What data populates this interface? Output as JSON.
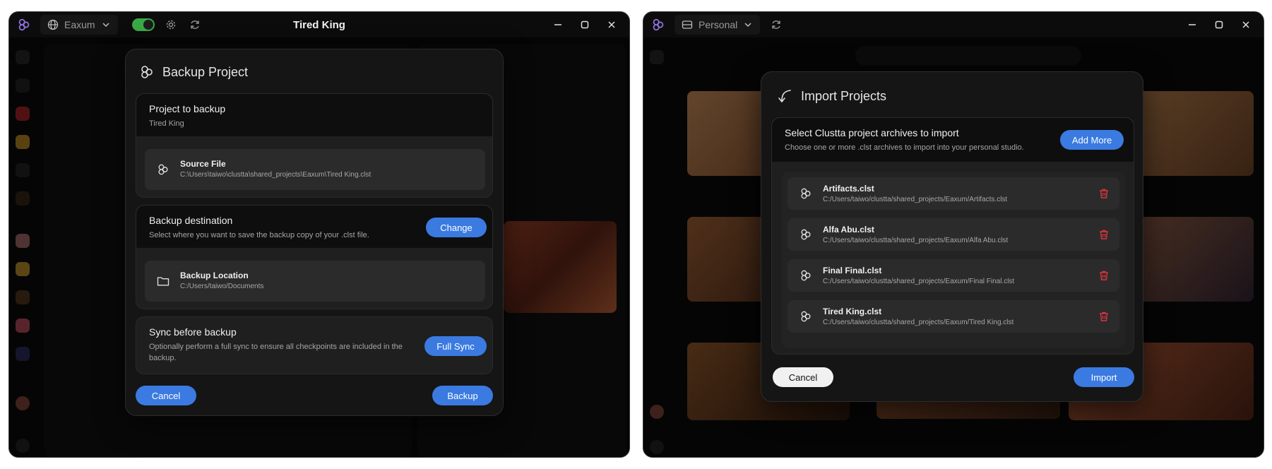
{
  "left_window": {
    "workspace": "Eaxum",
    "title": "Tired King",
    "modal": {
      "title": "Backup Project",
      "project_section": {
        "heading": "Project to backup",
        "project_name": "Tired King",
        "source_label": "Source File",
        "source_path": "C:\\Users\\taiwo\\clustta\\shared_projects\\Eaxum\\Tired King.clst"
      },
      "destination_section": {
        "heading": "Backup destination",
        "description": "Select where you want to save the backup copy of your .clst file.",
        "change_label": "Change",
        "location_label": "Backup Location",
        "location_path": "C:/Users/taiwo/Documents"
      },
      "sync_section": {
        "heading": "Sync before backup",
        "description": "Optionally perform a full sync to ensure all checkpoints are included in the backup.",
        "button_label": "Full Sync"
      },
      "cancel_label": "Cancel",
      "confirm_label": "Backup"
    }
  },
  "right_window": {
    "workspace": "Personal",
    "modal": {
      "title": "Import Projects",
      "heading": "Select Clustta project archives to import",
      "description": "Choose one or more .clst archives to import into your personal studio.",
      "add_more_label": "Add More",
      "files": [
        {
          "name": "Artifacts.clst",
          "path": "C:/Users/taiwo/clustta/shared_projects/Eaxum/Artifacts.clst"
        },
        {
          "name": "Alfa Abu.clst",
          "path": "C:/Users/taiwo/clustta/shared_projects/Eaxum/Alfa Abu.clst"
        },
        {
          "name": "Final Final.clst",
          "path": "C:/Users/taiwo/clustta/shared_projects/Eaxum/Final Final.clst"
        },
        {
          "name": "Tired King.clst",
          "path": "C:/Users/taiwo/clustta/shared_projects/Eaxum/Tired King.clst"
        }
      ],
      "cancel_label": "Cancel",
      "confirm_label": "Import"
    }
  },
  "colors": {
    "accent": "#3b7ae0",
    "toggle_on": "#39a845",
    "danger": "#d9363e",
    "brand": "#8b6fd6"
  }
}
